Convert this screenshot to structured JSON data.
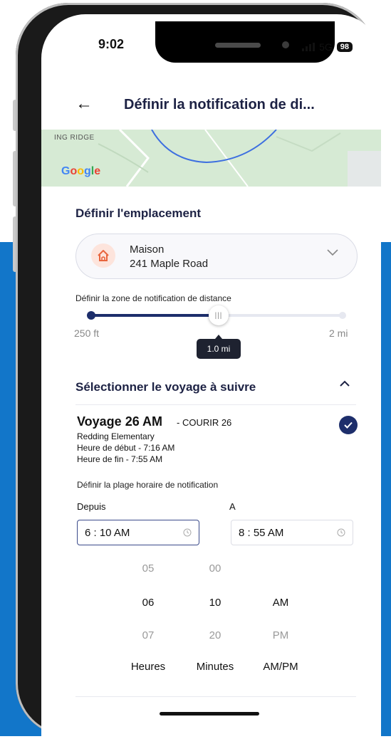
{
  "status": {
    "time": "9:02",
    "network": "5G",
    "battery": "98"
  },
  "header": {
    "title": "Définir la notification de di..."
  },
  "map": {
    "label": "ING RIDGE",
    "logo": "Google"
  },
  "location": {
    "section_title": "Définir l'emplacement",
    "name": "Maison",
    "address": "241 Maple Road"
  },
  "distance": {
    "title": "Définir la zone de notification de distance",
    "min_label": "250 ft",
    "max_label": "2 mi",
    "value_label": "1.0 mi",
    "fill_fraction": 0.51
  },
  "trip_section": {
    "title": "Sélectionner le voyage à suivre"
  },
  "trip": {
    "name": "Voyage 26 AM",
    "route": "- COURIR 26",
    "school": "Redding Elementary",
    "start": "Heure de début - 7:16 AM",
    "end": "Heure de fin - 7:55 AM",
    "selected": true
  },
  "time_range": {
    "title": "Définir la plage horaire de notification",
    "from_label": "Depuis",
    "to_label": "A",
    "from_value": "6 : 10 AM",
    "to_value": "8 : 55 AM"
  },
  "picker": {
    "hours": [
      "05",
      "06",
      "07"
    ],
    "minutes": [
      "00",
      "10",
      "20"
    ],
    "ampm": [
      "AM",
      "PM"
    ],
    "headers": {
      "hours": "Heures",
      "minutes": "Minutes",
      "ampm": "AM/PM"
    }
  },
  "colors": {
    "accent": "#1d2e6b",
    "background_band": "#1276c9",
    "home_icon": "#e8653e"
  }
}
